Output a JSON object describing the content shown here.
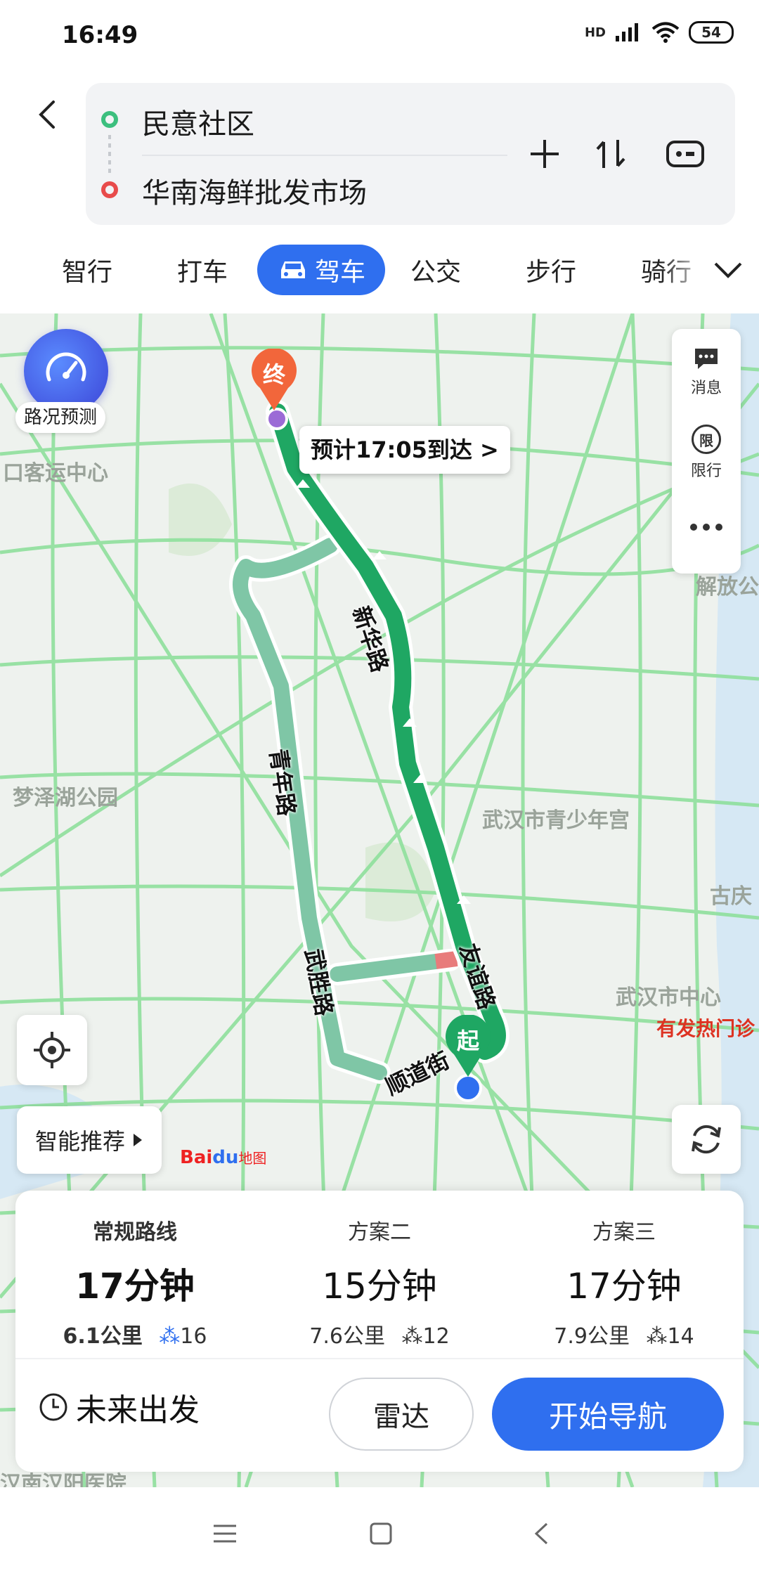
{
  "status": {
    "time": "16:49",
    "hd": "HD",
    "battery": "54"
  },
  "route": {
    "origin": "民意社区",
    "destination": "华南海鲜批发市场"
  },
  "modes": {
    "tabs": [
      "智行",
      "打车",
      "公交",
      "步行",
      "骑行"
    ],
    "active": "驾车"
  },
  "map": {
    "traffic_label": "路况预测",
    "side": {
      "messages": "消息",
      "restrict": "限行",
      "restrict_icon": "限"
    },
    "eta": "预计17:05到达 >",
    "end_pin": "终",
    "start_pin": "起",
    "smart": "智能推荐",
    "logo_text": "Bai",
    "logo_paw": "du",
    "logo_sub": "地图",
    "roads": {
      "r1": "新华路",
      "r2": "青年路",
      "r3": "武胜路",
      "r4": "友谊路",
      "r5": "顺道街"
    },
    "places": {
      "p1": "口客运中心",
      "p2": "梦泽湖公园",
      "p3": "武汉市青少年宫",
      "p4": "武汉市中心",
      "p5": "古庆",
      "p6": "解放公",
      "p7": "有发热门诊",
      "p8": "汉南汉阳医院"
    }
  },
  "plans": [
    {
      "name": "常规路线",
      "time": "17分钟",
      "distance": "6.1公里",
      "lights": "16"
    },
    {
      "name": "方案二",
      "time": "15分钟",
      "distance": "7.6公里",
      "lights": "12"
    },
    {
      "name": "方案三",
      "time": "17分钟",
      "distance": "7.9公里",
      "lights": "14"
    }
  ],
  "actions": {
    "future": "未来出发",
    "radar": "雷达",
    "navigate": "开始导航"
  },
  "colors": {
    "accent": "#2f6fef",
    "route_main": "#1fa763",
    "route_alt": "#7fc6a6",
    "start_dot": "#3cbf7e",
    "end_dot": "#e84b4b",
    "end_pin": "#f2663b"
  }
}
